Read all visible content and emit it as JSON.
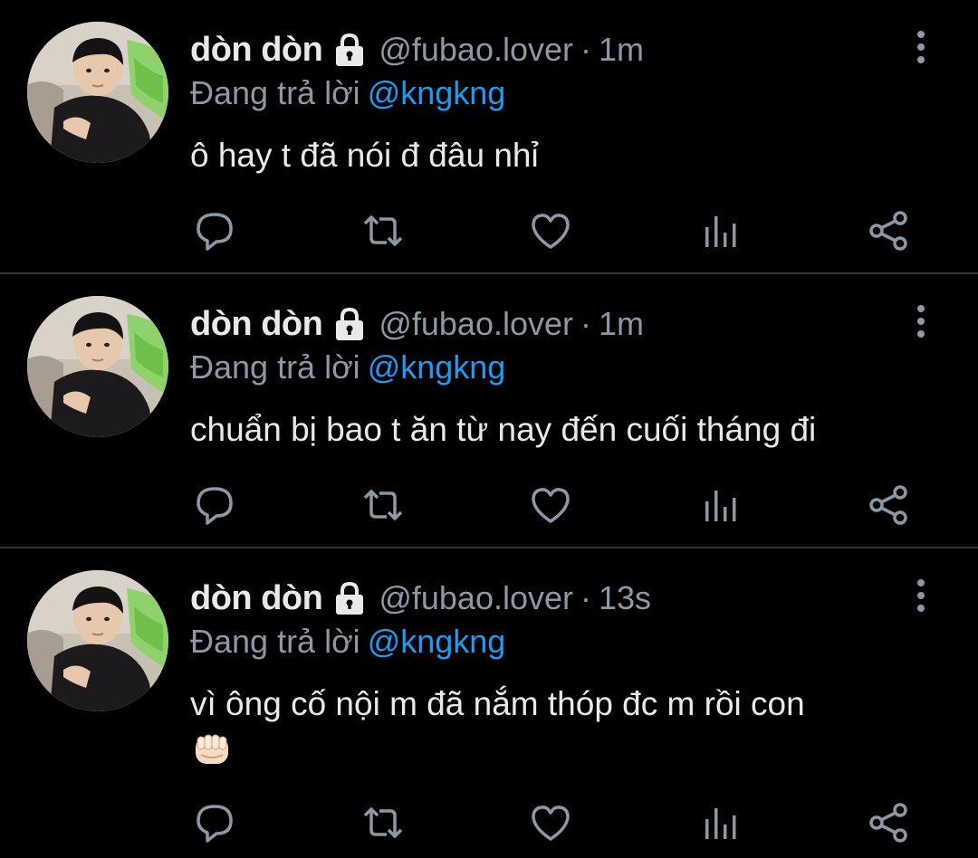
{
  "colors": {
    "background": "#000000",
    "primary_text": "#e7e9ea",
    "secondary_text": "#8b98a5",
    "mention_blue": "#1d9bf0",
    "divider": "#2f3336"
  },
  "icons": {
    "lock": "lock-icon",
    "more": "more-vertical-icon",
    "reply": "reply-icon",
    "retweet": "retweet-icon",
    "like": "heart-icon",
    "views": "views-icon",
    "share": "share-icon",
    "emoji": "fist-emoji-icon"
  },
  "tweets": [
    {
      "name": "dòn dòn",
      "handle": "@fubao.lover",
      "separator": "·",
      "time": "1m",
      "replying_label": "Đang trả lời",
      "replying_to": "@kngkng",
      "text": "ô hay t đã nói đ đâu nhỉ"
    },
    {
      "name": "dòn dòn",
      "handle": "@fubao.lover",
      "separator": "·",
      "time": "1m",
      "replying_label": "Đang trả lời",
      "replying_to": "@kngkng",
      "text": "chuẩn bị bao t ăn từ nay đến cuối tháng đi"
    },
    {
      "name": "dòn dòn",
      "handle": "@fubao.lover",
      "separator": "·",
      "time": "13s",
      "replying_label": "Đang trả lời",
      "replying_to": "@kngkng",
      "text": "vì ông cố nội m đã nắm thóp đc m rồi con"
    }
  ]
}
